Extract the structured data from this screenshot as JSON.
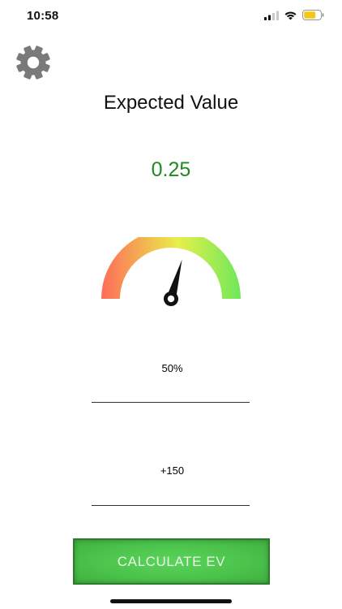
{
  "status_bar": {
    "time": "10:58",
    "icons": [
      "cellular-signal-icon",
      "wifi-icon",
      "battery-icon"
    ],
    "battery_color": "#f5c518"
  },
  "settings": {
    "icon": "gear-icon"
  },
  "header": {
    "title": "Expected Value"
  },
  "result": {
    "value": "0.25",
    "color": "#1f8a1f"
  },
  "gauge": {
    "level": 0.59,
    "gradient_colors": [
      "#ff6b5a",
      "#e8ef4a",
      "#6ee85a"
    ]
  },
  "inputs": {
    "win_probability": {
      "value": "50%"
    },
    "odds": {
      "value": "+150"
    }
  },
  "actions": {
    "calculate_label": "CALCULATE EV",
    "button_color": "#4cc44c"
  }
}
